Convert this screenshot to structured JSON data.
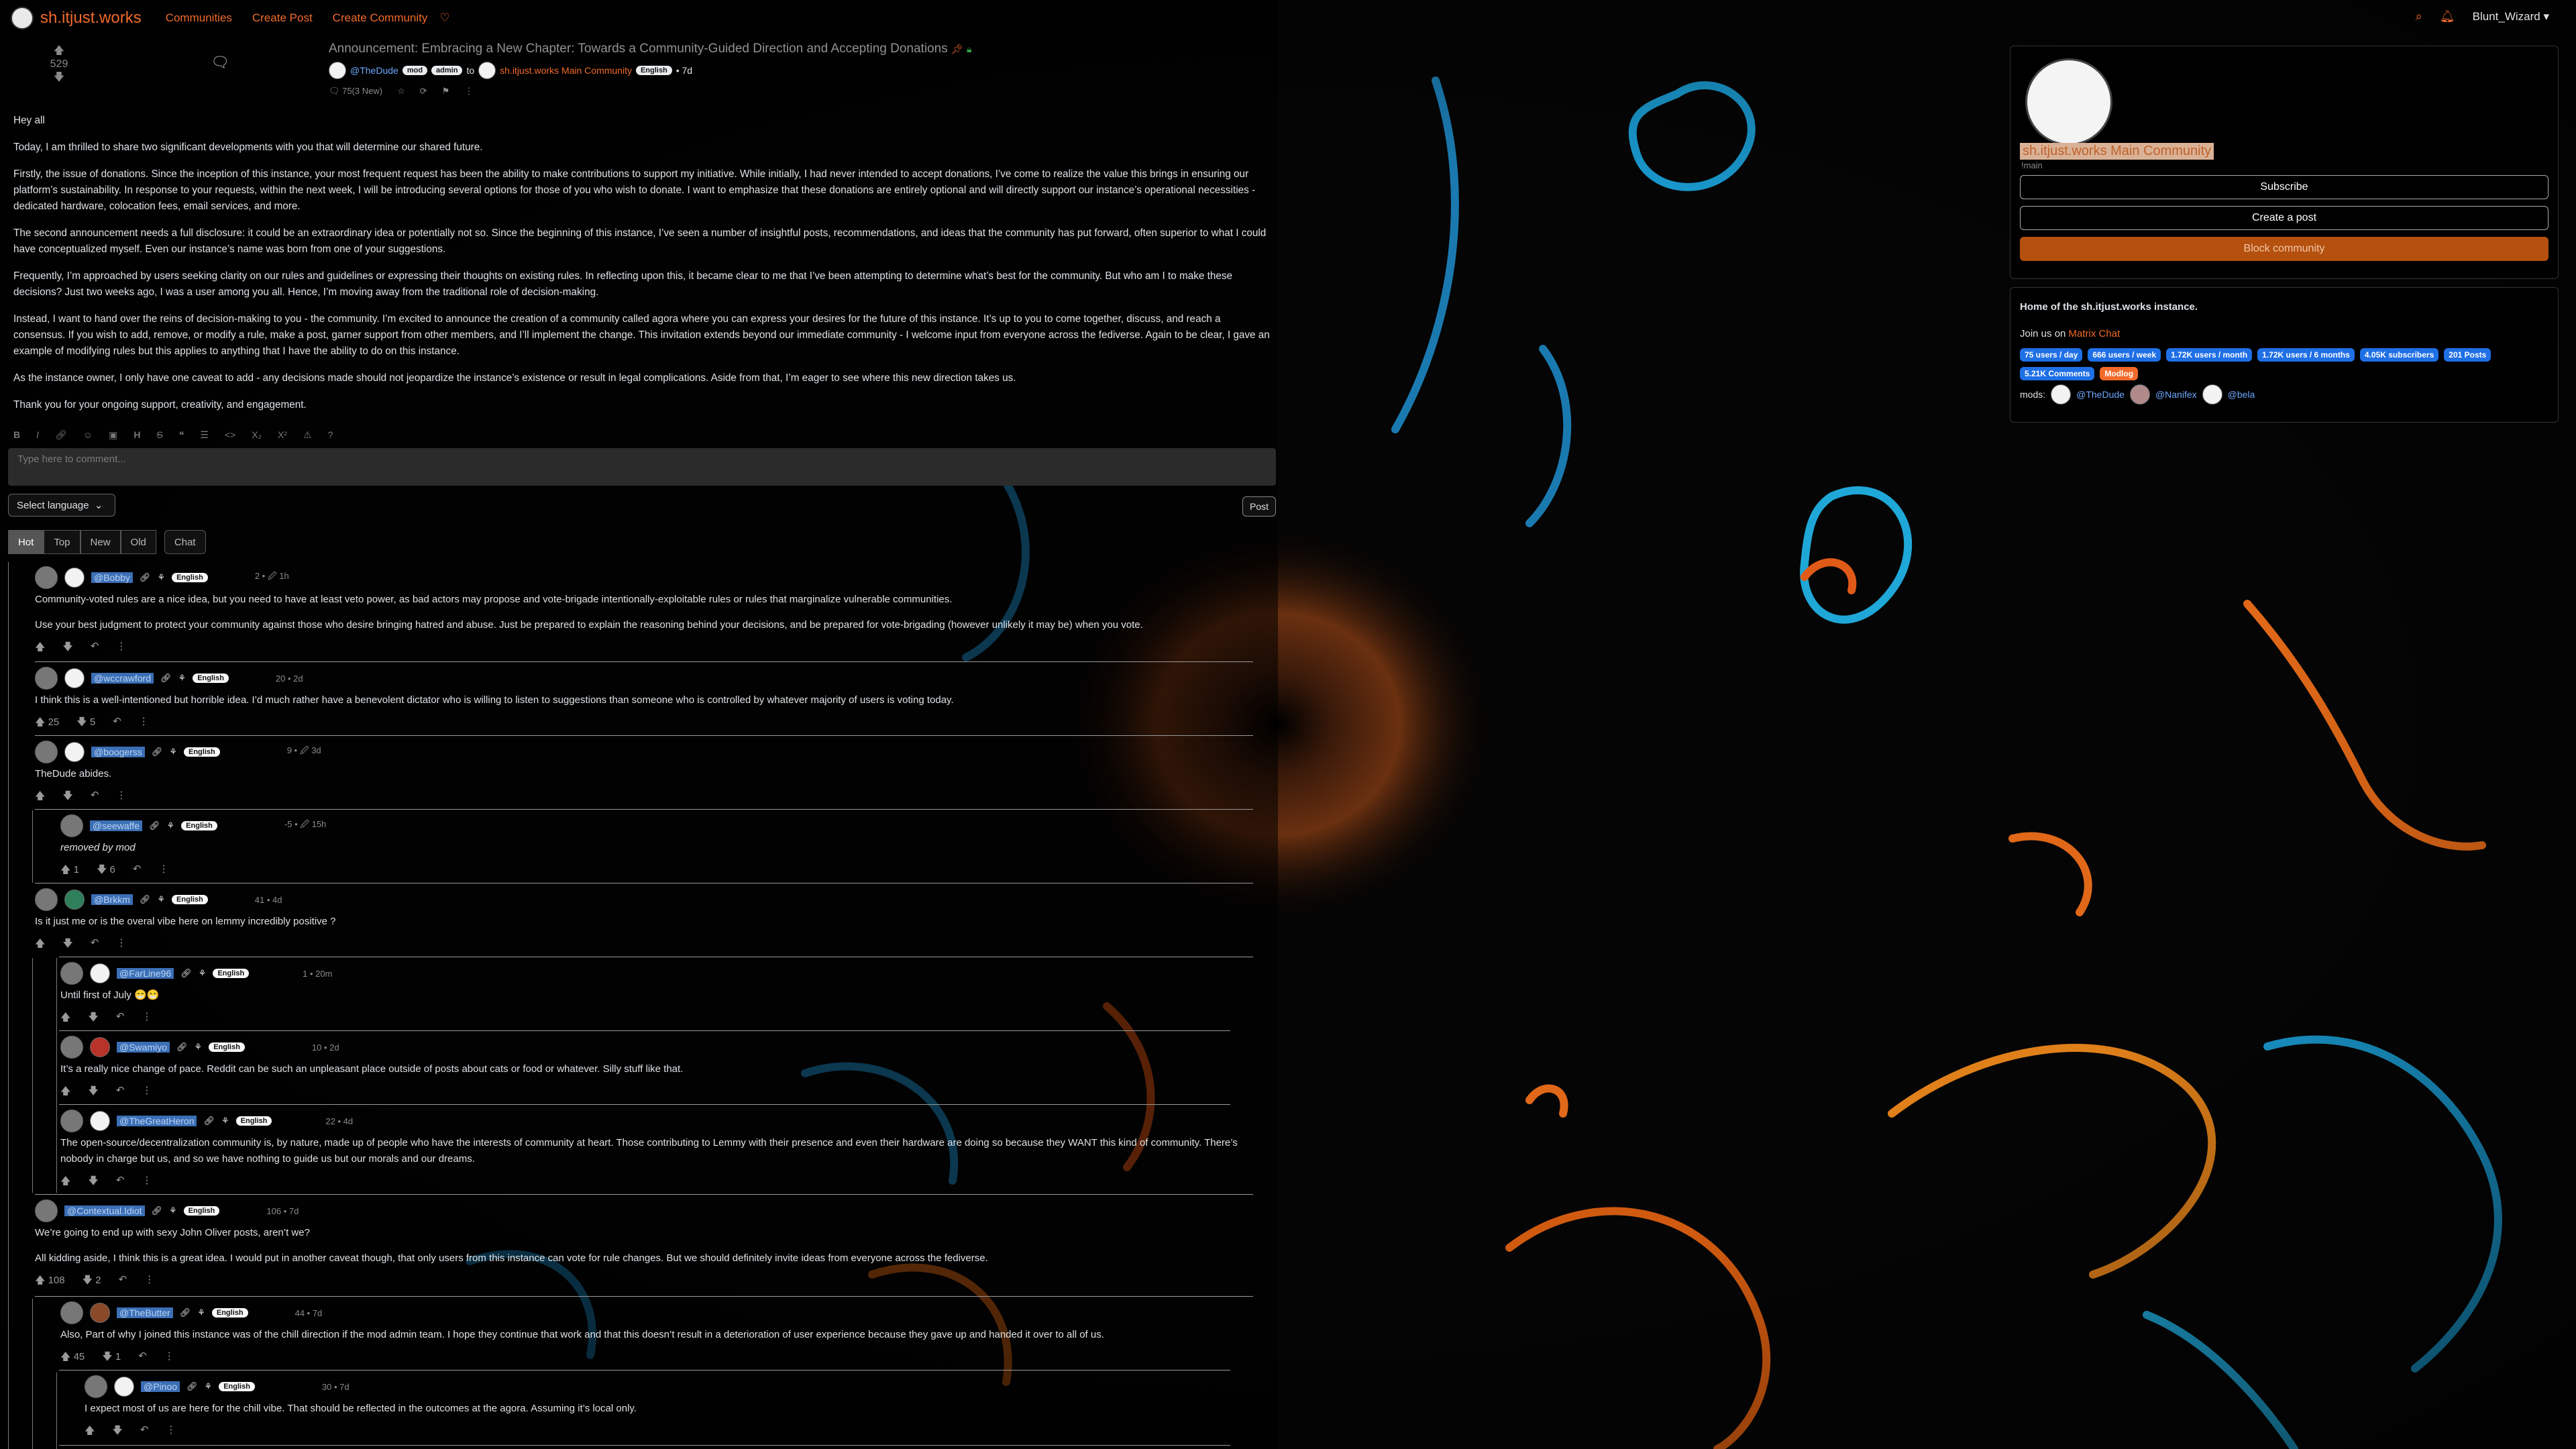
{
  "navbar": {
    "brand": "sh.itjust.works",
    "links": [
      "Communities",
      "Create Post",
      "Create Community"
    ],
    "user": "Blunt_Wizard"
  },
  "post": {
    "score": "529",
    "title": "Announcement: Embracing a New Chapter: Towards a Community-Guided Direction and Accepting Donations",
    "author": "@TheDude",
    "badge_mod": "mod",
    "badge_admin": "admin",
    "to": "to",
    "community": "sh.itjust.works Main Community",
    "lang": "English",
    "time": "7d",
    "comments": "75(3 New)",
    "paragraphs": [
      "Hey all",
      "Today, I am thrilled to share two significant developments with you that will determine our shared future.",
      "Firstly, the issue of donations. Since the inception of this instance, your most frequent request has been the ability to make contributions to support my initiative. While initially, I had never intended to accept donations, I’ve come to realize the value this brings in ensuring our platform’s sustainability. In response to your requests, within the next week, I will be introducing several options for those of you who wish to donate. I want to emphasize that these donations are entirely optional and will directly support our instance’s operational necessities - dedicated hardware, colocation fees, email services, and more.",
      "The second announcement needs a full disclosure: it could be an extraordinary idea or potentially not so. Since the beginning of this instance, I’ve seen a number of insightful posts, recommendations, and ideas that the community has put forward, often superior to what I could have conceptualized myself. Even our instance’s name was born from one of your suggestions.",
      "Frequently, I’m approached by users seeking clarity on our rules and guidelines or expressing their thoughts on existing rules. In reflecting upon this, it became clear to me that I’ve been attempting to determine what’s best for the community. But who am I to make these decisions? Just two weeks ago, I was a user among you all. Hence, I’m moving away from the traditional role of decision-making.",
      "Instead, I want to hand over the reins of decision-making to you - the community. I’m excited to announce the creation of a community called agora where you can express your desires for the future of this instance. It’s up to you to come together, discuss, and reach a consensus. If you wish to add, remove, or modify a rule, make a post, garner support from other members, and I’ll implement the change. This invitation extends beyond our immediate community - I welcome input from everyone across the fediverse. Again to be clear, I gave an example of modifying rules but this applies to anything that I have the ability to do on this instance.",
      "As the instance owner, I only have one caveat to add - any decisions made should not jeopardize the instance’s existence or result in legal complications. Aside from that, I’m eager to see where this new direction takes us.",
      "Thank you for your ongoing support, creativity, and engagement."
    ]
  },
  "editor": {
    "placeholder": "Type here to comment...",
    "language": "Select language",
    "post": "Post"
  },
  "sort": {
    "tabs": [
      "Hot",
      "Top",
      "New",
      "Old"
    ],
    "chat": "Chat"
  },
  "comments": [
    {
      "user": "@Bobby",
      "lang": "English",
      "meta": "2 • 🖉 1h",
      "body": [
        "Community-voted rules are a nice idea, but you need to have at least veto power, as bad actors may propose and vote-brigade intentionally-exploitable rules or rules that marginalize vulnerable communities.",
        "Use your best judgment to protect your community against those who desire bringing hatred and abuse. Just be prepared to explain the reasoning behind your decisions, and be prepared for vote-brigading (however unlikely it may be) when you vote."
      ],
      "up": "",
      "down": ""
    },
    {
      "user": "@wccrawford",
      "lang": "English",
      "meta": "20 • 2d",
      "body": [
        "I think this is a well-intentioned but horrible idea. I’d much rather have a benevolent dictator who is willing to listen to suggestions than someone who is controlled by whatever majority of users is voting today."
      ],
      "up": "25",
      "down": "5"
    },
    {
      "user": "@boogerss",
      "lang": "English",
      "meta": "9 • 🖉 3d",
      "body": [
        "TheDude abides."
      ],
      "up": "",
      "down": ""
    },
    {
      "user": "@seewaffe",
      "lang": "English",
      "meta": "-5 • 🖉 15h",
      "body": [
        "removed by mod"
      ],
      "up": "1",
      "down": "6"
    },
    {
      "user": "@Brkkm",
      "lang": "English",
      "meta": "41 • 4d",
      "body": [
        "Is it just me or is the overal vibe here on lemmy incredibly positive ?"
      ],
      "up": "",
      "down": ""
    },
    {
      "user": "@FarLine96",
      "lang": "English",
      "meta": "1 • 20m",
      "body": [
        "Until first of July 😁😁"
      ],
      "up": "",
      "down": ""
    },
    {
      "user": "@Swamiyo",
      "lang": "English",
      "meta": "10 • 2d",
      "body": [
        "It’s a really nice change of pace. Reddit can be such an unpleasant place outside of posts about cats or food or whatever. Silly stuff like that."
      ],
      "up": "",
      "down": ""
    },
    {
      "user": "@TheGreatHeron",
      "lang": "English",
      "meta": "22 • 4d",
      "body": [
        "The open-source/decentralization community is, by nature, made up of people who have the interests of community at heart. Those contributing to Lemmy with their presence and even their hardware are doing so because they WANT this kind of community. There’s nobody in charge but us, and so we have nothing to guide us but our morals and our dreams."
      ],
      "up": "",
      "down": ""
    },
    {
      "user": "@Contextual.Idiot",
      "lang": "English",
      "meta": "106 • 7d",
      "body": [
        "We’re going to end up with sexy John Oliver posts, aren’t we?",
        "All kidding aside, I think this is a great idea. I would put in another caveat though, that only users from this instance can vote for rule changes. But we should definitely invite ideas from everyone across the fediverse."
      ],
      "up": "108",
      "down": "2"
    },
    {
      "user": "@TheButter",
      "lang": "English",
      "meta": "44 • 7d",
      "body": [
        "Also, Part of why I joined this instance was of the chill direction if the mod admin team. I hope they continue that work and that this doesn’t result in a deterioration of user experience because they gave up and handed it over to all of us."
      ],
      "up": "45",
      "down": "1"
    },
    {
      "user": "@Pinoo",
      "lang": "English",
      "meta": "30 • 7d",
      "body": [
        "I expect most of us are here for the chill vibe. That should be reflected in the outcomes at the agora. Assuming it’s local only."
      ],
      "up": "",
      "down": ""
    }
  ],
  "sidebar": {
    "title": "sh.itjust.works Main Community",
    "sub": "!main",
    "subscribe": "Subscribe",
    "create": "Create a post",
    "block": "Block community",
    "home": "Home of the sh.itjust.works instance.",
    "join_prefix": "Join us on ",
    "join_link": "Matrix Chat",
    "badges": [
      "75 users / day",
      "666 users / week",
      "1.72K users / month",
      "1.72K users / 6 months",
      "4.05K subscribers",
      "201 Posts",
      "5.21K Comments"
    ],
    "mod_badge": "Modlog",
    "mods_label": "mods:",
    "mods": [
      "@TheDude",
      "@Nanifex",
      "@bela"
    ]
  },
  "colors": {
    "accent": "#f06a2b",
    "badge": "#1f6fe5",
    "block": "#b5500f"
  }
}
